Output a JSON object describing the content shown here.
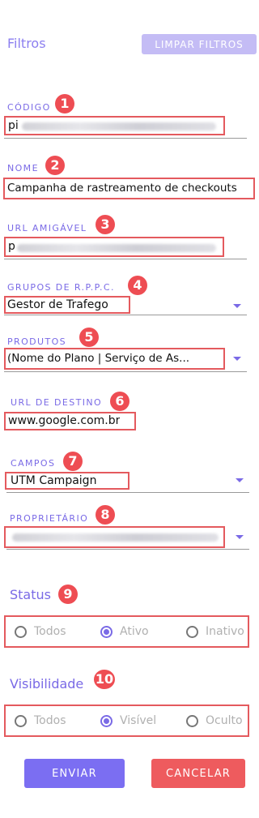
{
  "header": {
    "title": "Filtros",
    "clear_label": "LIMPAR FILTROS"
  },
  "fields": {
    "codigo": {
      "label": "CÓDIGO",
      "value": "pi",
      "badge": "1"
    },
    "nome": {
      "label": "NOME",
      "value": "Campanha de rastreamento de checkouts",
      "badge": "2"
    },
    "url_amigavel": {
      "label": "URL AMIGÁVEL",
      "value": "p",
      "badge": "3"
    },
    "grupos": {
      "label": "GRUPOS DE R.P.P.C.",
      "value": "Gestor de Trafego",
      "badge": "4"
    },
    "produtos": {
      "label": "PRODUTOS",
      "value": "(Nome do Plano | Serviço de As...",
      "badge": "5"
    },
    "url_destino": {
      "label": "URL DE DESTINO",
      "value": "www.google.com.br",
      "badge": "6"
    },
    "campos": {
      "label": "CAMPOS",
      "value": "UTM Campaign",
      "badge": "7"
    },
    "proprietario": {
      "label": "PROPRIETÁRIO",
      "value": "",
      "badge": "8"
    }
  },
  "status": {
    "title": "Status",
    "badge": "9",
    "options": [
      "Todos",
      "Ativo",
      "Inativo"
    ],
    "selected": "Ativo"
  },
  "visibilidade": {
    "title": "Visibilidade",
    "badge": "10",
    "options": [
      "Todos",
      "Visível",
      "Oculto"
    ],
    "selected": "Visível"
  },
  "actions": {
    "send_label": "ENVIAR",
    "cancel_label": "CANCELAR"
  },
  "colors": {
    "accent": "#7a6ae6",
    "annotation_red": "#ee4d53",
    "cancel": "#ee5b5e"
  },
  "icons": {
    "dropdown": "caret-down-icon"
  }
}
